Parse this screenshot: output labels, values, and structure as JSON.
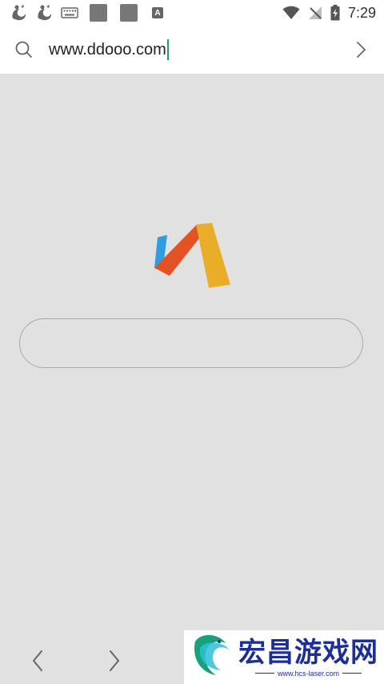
{
  "status_bar": {
    "time": "7:29",
    "a_badge": "A",
    "icons": [
      "uc-browser-icon",
      "uc-browser-icon",
      "keyboard-icon",
      "gray-square-icon",
      "gray-square-icon",
      "a-text-icon",
      "wifi-icon",
      "no-signal-icon",
      "battery-charging-icon"
    ]
  },
  "address_bar": {
    "url": "www.ddooo.com",
    "icons": [
      "search-icon",
      "chevron-right-icon"
    ]
  },
  "main": {
    "search_placeholder": "",
    "logo": "via-browser-logo",
    "logo_colors": [
      "#2e9ee0",
      "#e35225",
      "#e9ad28"
    ]
  },
  "bottom_nav": {
    "icons": [
      "back-arrow-icon",
      "forward-arrow-icon"
    ]
  },
  "watermark": {
    "title": "宏昌游戏网",
    "url": "www.hcs-laser.com",
    "color": "#1d2e98"
  }
}
